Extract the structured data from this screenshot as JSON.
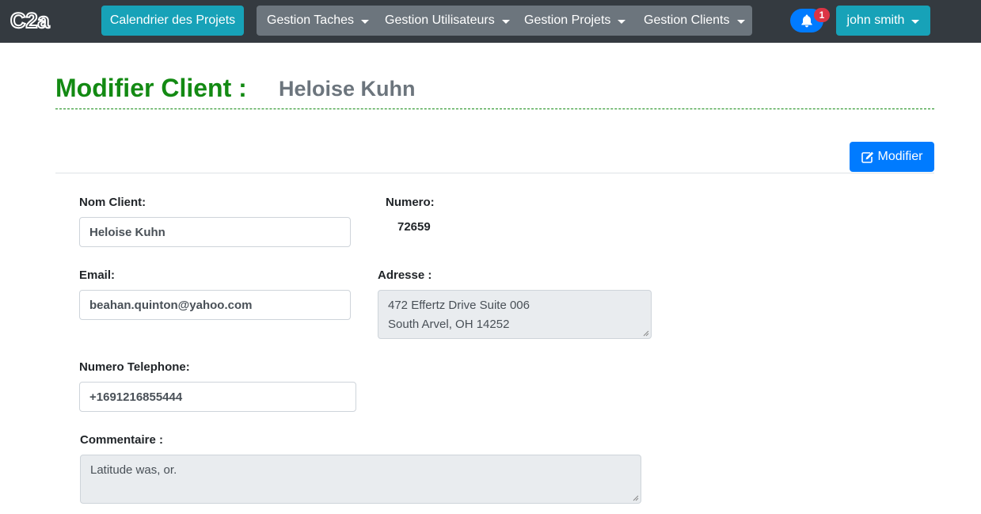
{
  "nav": {
    "logo_text": "C2a",
    "calendar_label": "Calendrier des Projets",
    "menus": [
      {
        "label": "Gestion Taches"
      },
      {
        "label": "Gestion Utilisateurs"
      },
      {
        "label": "Gestion Projets"
      },
      {
        "label": "Gestion Clients"
      }
    ],
    "notification_count": "1",
    "user_label": "john smith"
  },
  "header": {
    "title": "Modifier Client :",
    "client_name": "Heloise Kuhn",
    "edit_button": "Modifier"
  },
  "form": {
    "nom_label": "Nom Client:",
    "nom_value": "Heloise Kuhn",
    "numero_label": "Numero:",
    "numero_value": "72659",
    "email_label": "Email:",
    "email_value": "beahan.quinton@yahoo.com",
    "adresse_label": "Adresse :",
    "adresse_line1": "472 Effertz Drive Suite 006",
    "adresse_line2": "South Arvel, OH 14252",
    "tel_label": "Numero Telephone:",
    "tel_value": "+1691216855444",
    "comment_label": "Commentaire :",
    "comment_value": "Latitude was, or."
  },
  "colors": {
    "navbar": "#343a40",
    "info": "#17a2b8",
    "secondary": "#6c757d",
    "primary": "#007bff",
    "danger": "#dc3545",
    "title_green": "#138a13"
  }
}
